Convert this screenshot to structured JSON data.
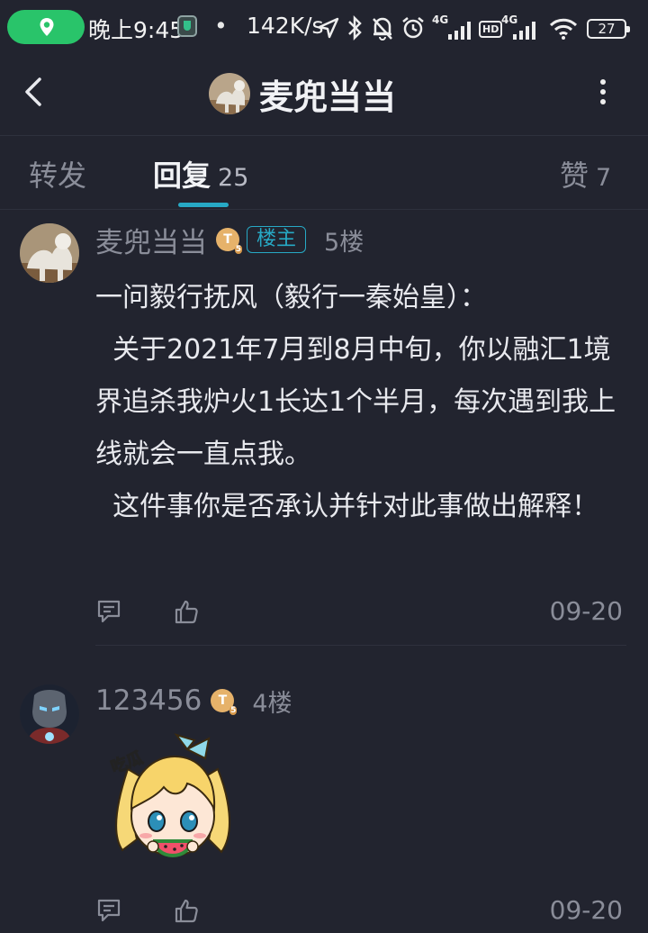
{
  "status_bar": {
    "time": "晚上9:45",
    "dot": "•",
    "net_speed": "142K/s",
    "network_1": "4G",
    "network_2": "4G",
    "hd": "HD",
    "battery": "27"
  },
  "header": {
    "title": "麦兜当当"
  },
  "tabs": [
    {
      "label": "转发",
      "count": ""
    },
    {
      "label": "回复",
      "count": "25"
    },
    {
      "label": "赞",
      "count": "7"
    }
  ],
  "posts": [
    {
      "username": "麦兜当当",
      "level": "T",
      "op_badge": "楼主",
      "floor": "5楼",
      "content": "一问毅行抚风（毅行一秦始皇）：\n  关于2021年7月到8月中旬，你以融汇1境界追杀我炉火1长达1个半月，每次遇到我上线就会一直点我。\n  这件事你是否承认并针对此事做出解释！",
      "date": "09-20"
    },
    {
      "username": "123456",
      "level": "T",
      "floor": "4楼",
      "content": "",
      "sticker_text": "吃瓜",
      "date": "09-20"
    }
  ],
  "colors": {
    "background": "#22242f",
    "accent": "#27a9c5",
    "muted_text": "#8a8d99",
    "location_pill": "#29c46a"
  }
}
